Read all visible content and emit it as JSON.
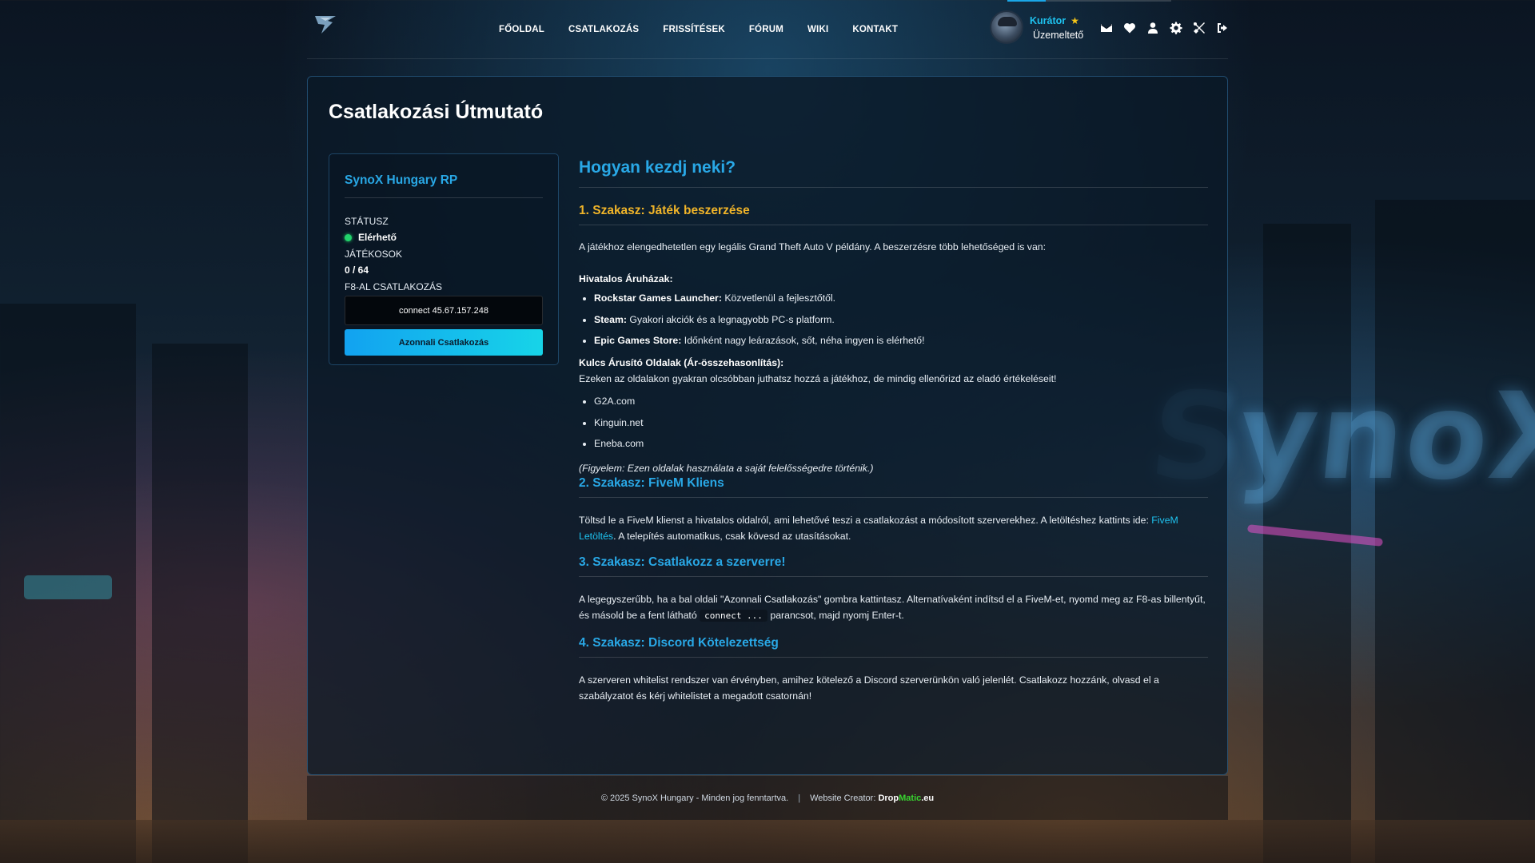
{
  "colors": {
    "accent": "#29a8e6",
    "gold": "#f0b429",
    "online": "#22d36b",
    "button_gradient_start": "#12a2f0",
    "button_gradient_end": "#17d4e8"
  },
  "background": {
    "watermark": "SynoX"
  },
  "header": {
    "logo": "synox-logo-icon",
    "nav": [
      "FŐOLDAL",
      "CSATLAKOZÁS",
      "FRISSÍTÉSEK",
      "FÓRUM",
      "WIKI",
      "KONTAKT"
    ],
    "user": {
      "name": "Kurátor",
      "role": "Üzemeltető"
    },
    "icons": [
      "mail-icon",
      "heart-icon",
      "user-icon",
      "gear-icon",
      "tools-icon",
      "logout-icon"
    ]
  },
  "page": {
    "title": "Csatlakozási Útmutató"
  },
  "server": {
    "name": "SynoX Hungary RP",
    "status_label": "STÁTUSZ",
    "status_value": "Elérhető",
    "players_label": "JÁTÉKOSOK",
    "players_value": "0 / 64",
    "f8_label": "F8-AL CSATLAKOZÁS",
    "connect_command": "connect 45.67.157.248",
    "join_button": "Azonnali Csatlakozás"
  },
  "guide": {
    "title": "Hogyan kezdj neki?",
    "s1": {
      "title": "1. Szakasz: Játék beszerzése",
      "intro": "A játékhoz elengedhetetlen egy legális Grand Theft Auto V példány. A beszerzésre több lehetőséged is van:",
      "official_heading": "Hivatalos Áruházak:",
      "official": [
        {
          "name": "Rockstar Games Launcher:",
          "desc": " Közvetlenül a fejlesztőtől."
        },
        {
          "name": "Steam:",
          "desc": " Gyakori akciók és a legnagyobb PC-s platform."
        },
        {
          "name": "Epic Games Store:",
          "desc": " Időnként nagy leárazások, sőt, néha ingyen is elérhető!"
        }
      ],
      "keys_heading": "Kulcs Árusító Oldalak (Ár-összehasonlítás):",
      "keys_intro": "Ezeken az oldalakon gyakran olcsóbban juthatsz hozzá a játékhoz, de mindig ellenőrizd az eladó értékeléseit!",
      "key_sites": [
        "G2A.com",
        "Kinguin.net",
        "Eneba.com"
      ],
      "note": "(Figyelem: Ezen oldalak használata a saját felelősségedre történik.)"
    },
    "s2": {
      "title": "2. Szakasz: FiveM Kliens",
      "text_before": "Töltsd le a FiveM klienst a hivatalos oldalról, ami lehetővé teszi a csatlakozást a módosított szerverekhez. A letöltéshez kattints ide: ",
      "link": "FiveM Letöltés",
      "text_after": ". A telepítés automatikus, csak kövesd az utasításokat."
    },
    "s3": {
      "title": "3. Szakasz: Csatlakozz a szerverre!",
      "text_before": "A legegyszerűbb, ha a bal oldali \"Azonnali Csatlakozás\" gombra kattintasz. Alternatívaként indítsd el a FiveM-et, nyomd meg az F8-as billentyűt, és másold be a fent látható ",
      "code": "connect ...",
      "text_after": " parancsot, majd nyomj Enter-t."
    },
    "s4": {
      "title": "4. Szakasz: Discord Kötelezettség",
      "text": "A szerveren whitelist rendszer van érvényben, amihez kötelező a Discord szerverünkön való jelenlét. Csatlakozz hozzánk, olvasd el a szabályzatot és kérj whitelistet a megadott csatornán!"
    }
  },
  "footer": {
    "copyright": "© 2025 SynoX Hungary - Minden jog fenntartva.",
    "separator": "|",
    "creator_label": "Website Creator:",
    "creator_part1": "Drop",
    "creator_part2": "Matic",
    "creator_part3": ".eu"
  }
}
